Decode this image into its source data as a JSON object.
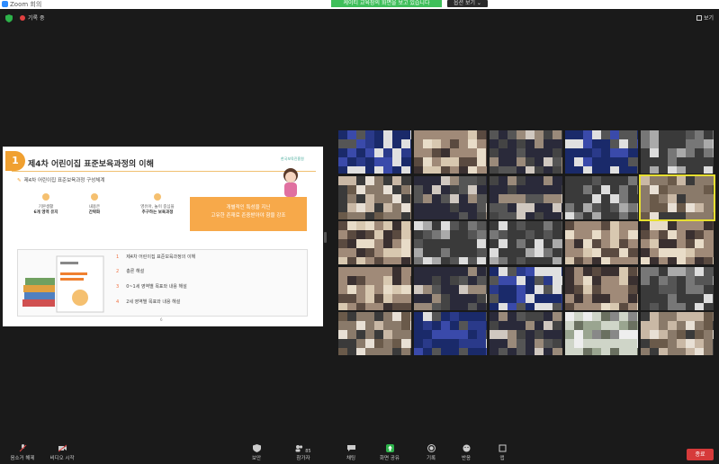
{
  "window": {
    "app_title": "Zoom 회의"
  },
  "banner": {
    "text": "케이티 교육장의 화면을 보고 있습니다",
    "view_options": "옵션 보기 ⌄"
  },
  "topbar": {
    "recording": "기록 중",
    "view": "보기"
  },
  "slide": {
    "number": "1",
    "title": "제4차 어린이집 표준보육과정의 이해",
    "org": "한국보육진흥원",
    "subtitle": "제4차 어린이집 표준보육과정 구성체계",
    "boxes": [
      {
        "l1": "기본생활",
        "l2": "6개 영역 유지"
      },
      {
        "l1": "내용은",
        "l2": "간략화"
      },
      {
        "l1": "영유아, 놀이 중심을",
        "l2": "추구하는 보육과정"
      }
    ],
    "orange_l1": "개별적인 특성을 지닌",
    "orange_l2": "고유한 존재로 존중받아야 함을 강조",
    "items": [
      {
        "n": "1",
        "text": "제4차 어린이집 표준보육과정의 이해"
      },
      {
        "n": "2",
        "text": "총론 해설"
      },
      {
        "n": "3",
        "text": "0~1세 영역별 목표와 내용 해설"
      },
      {
        "n": "4",
        "text": "2세 영역별 목표와 내용 해설"
      }
    ],
    "page": "6"
  },
  "toolbar": {
    "mute": "음소거 해제",
    "video": "비디오 시작",
    "security": "보안",
    "participants": "참가자",
    "participant_count": "85",
    "chat": "채팅",
    "share": "화면 공유",
    "record": "기록",
    "reactions": "반응",
    "apps": "앱",
    "end": "종료"
  },
  "colors": {
    "accent": "#f0a030",
    "share_green": "#2db24a",
    "end_red": "#d63a3a",
    "banner_green": "#3fbf5a"
  }
}
